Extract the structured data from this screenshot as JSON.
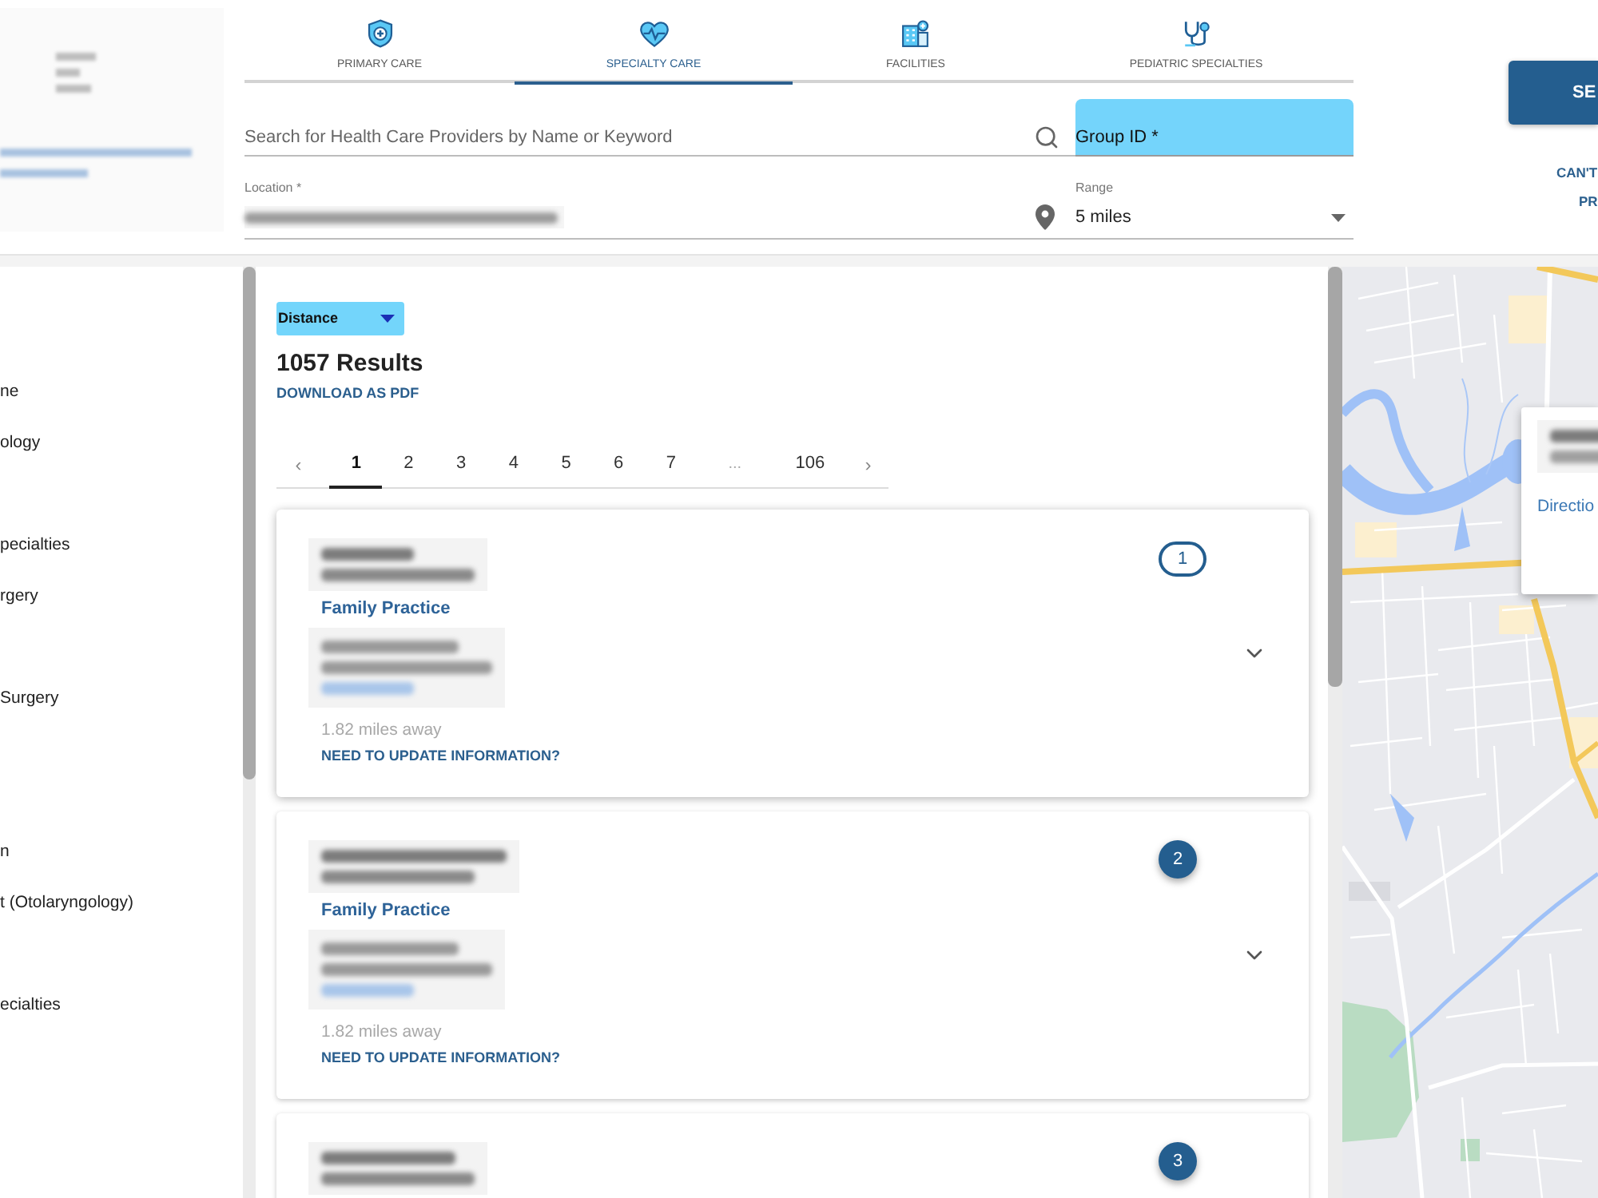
{
  "tabs": [
    {
      "label": "PRIMARY CARE",
      "selected": false
    },
    {
      "label": "SPECIALTY CARE",
      "selected": true
    },
    {
      "label": "FACILITIES",
      "selected": false
    },
    {
      "label": "PEDIATRIC SPECIALTIES",
      "selected": false
    }
  ],
  "search": {
    "placeholder": "Search for Health Care Providers by Name or Keyword"
  },
  "group_id": {
    "placeholder": "Group ID *"
  },
  "location": {
    "label": "Location *"
  },
  "range": {
    "label": "Range",
    "value": "5 miles"
  },
  "search_button": {
    "label": "SE"
  },
  "cant_find_link": {
    "lines": [
      "CAN'T",
      "PR"
    ]
  },
  "sidebar": {
    "items": [
      "ne",
      "ology",
      "pecialties",
      "rgery",
      "Surgery",
      "n",
      "t (Otolaryngology)",
      "ecialties"
    ]
  },
  "sort": {
    "value": "Distance"
  },
  "results_count": "1057 Results",
  "download_link": "DOWNLOAD AS PDF",
  "pagination": {
    "prev": "‹",
    "next": "›",
    "pages": [
      {
        "label": "1",
        "kind": "page",
        "selected": true
      },
      {
        "label": "2",
        "kind": "page",
        "selected": false
      },
      {
        "label": "3",
        "kind": "page",
        "selected": false
      },
      {
        "label": "4",
        "kind": "page",
        "selected": false
      },
      {
        "label": "5",
        "kind": "page",
        "selected": false
      },
      {
        "label": "6",
        "kind": "page",
        "selected": false
      },
      {
        "label": "7",
        "kind": "page",
        "selected": false
      },
      {
        "label": "...",
        "kind": "ellipsis",
        "selected": false
      },
      {
        "label": "106",
        "kind": "page",
        "selected": false
      }
    ]
  },
  "results": [
    {
      "marker": "1",
      "selected": true,
      "specialty": "Family Practice",
      "distance": "1.82 miles away",
      "update_link": "NEED TO UPDATE INFORMATION?"
    },
    {
      "marker": "2",
      "selected": false,
      "specialty": "Family Practice",
      "distance": "1.82 miles away",
      "update_link": "NEED TO UPDATE INFORMATION?"
    },
    {
      "marker": "3",
      "selected": false
    }
  ],
  "map": {
    "popup": {
      "link": "Directio"
    }
  }
}
